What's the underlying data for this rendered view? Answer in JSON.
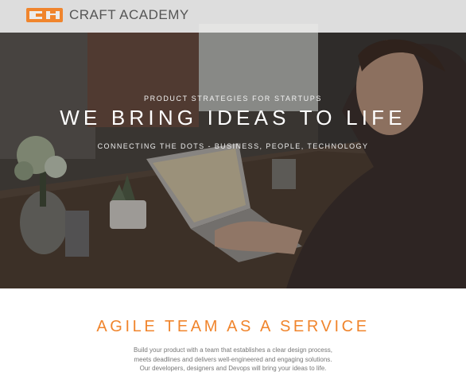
{
  "brand": {
    "name": "CRAFT ACADEMY",
    "accent": "#f0852d"
  },
  "hero": {
    "kicker": "PRODUCT STRATEGIES FOR STARTUPS",
    "headline": "WE BRING IDEAS TO LIFE",
    "subline": "CONNECTING THE DOTS - BUSINESS, PEOPLE, TECHNOLOGY"
  },
  "section": {
    "title": "AGILE TEAM AS A SERVICE",
    "body": [
      "Build your product with a team that establishes a clear design process,",
      "meets deadlines and delivers well-engineered and engaging solutions.",
      "Our developers, designers and Devops will bring your ideas to life."
    ]
  }
}
